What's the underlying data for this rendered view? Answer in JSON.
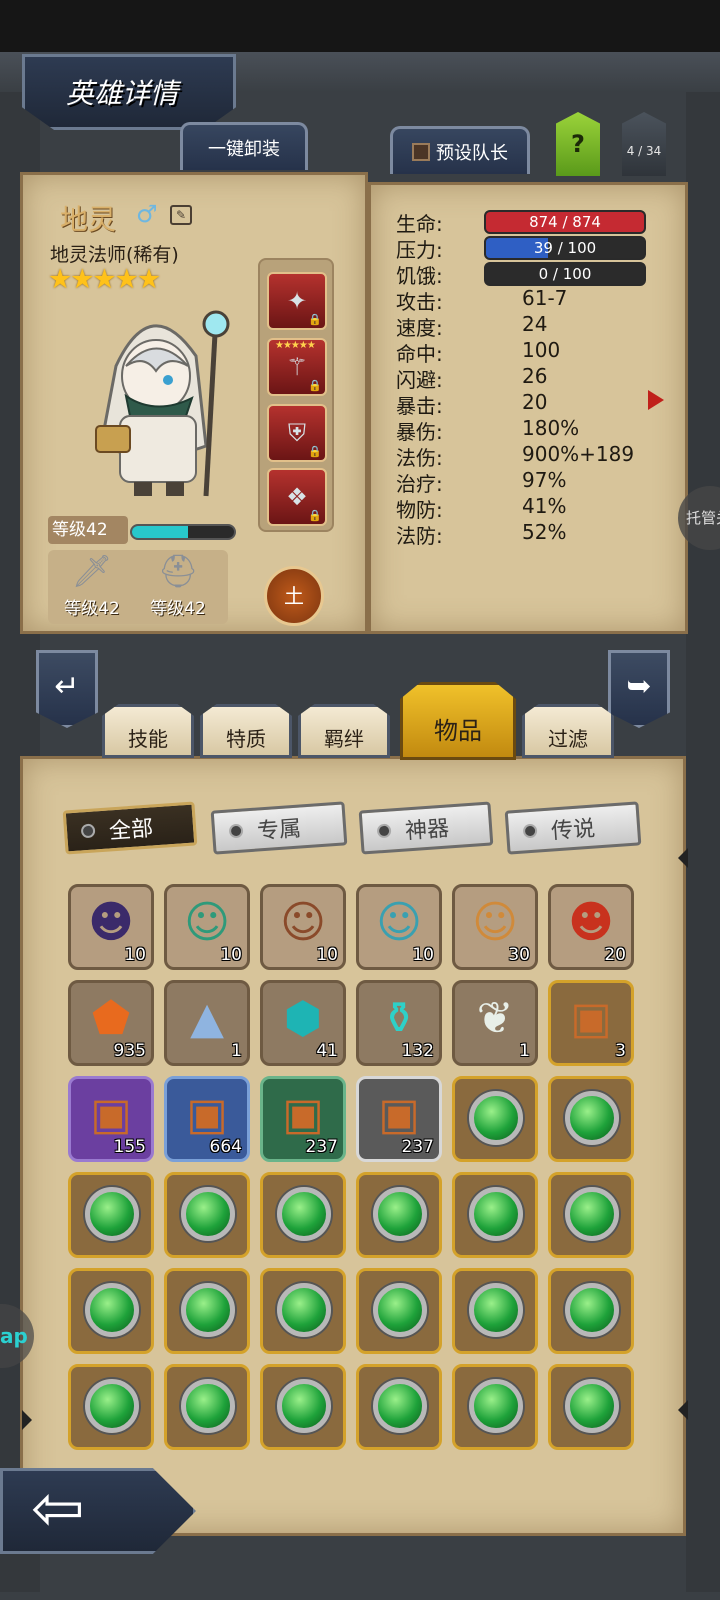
{
  "header": {
    "title": "英雄详情"
  },
  "top_buttons": {
    "unequip_all": "一键卸装",
    "preset_leader": "预设队长",
    "help": "?",
    "hero_count": "4 / 34"
  },
  "hero": {
    "name": "地灵",
    "gender_icon": "male-icon",
    "class": "地灵法师(稀有)",
    "stars": "★★★★★",
    "level_label": "等级42",
    "xp_progress": 0.55,
    "element": "土",
    "weapon_level": "等级42",
    "armor_level": "等级42",
    "equip_slots": [
      {
        "icon": "shuriken-icon",
        "glyph": "✦"
      },
      {
        "icon": "staff-icon",
        "glyph": "⚚",
        "stars": "★★★★★"
      },
      {
        "icon": "helmet-icon",
        "glyph": "⛨"
      },
      {
        "icon": "cloak-icon",
        "glyph": "❖"
      }
    ]
  },
  "stats": {
    "hp": {
      "label": "生命:",
      "value": "874 / 874",
      "ratio": 1.0,
      "color": "#c52a32"
    },
    "stress": {
      "label": "压力:",
      "value": "39 / 100",
      "ratio": 0.39,
      "color": "#2f5fc4"
    },
    "hunger": {
      "label": "饥饿:",
      "value": "0 / 100",
      "ratio": 0.0,
      "color": "#888888"
    },
    "rows": [
      {
        "label": "攻击:",
        "value": "61-7"
      },
      {
        "label": "速度:",
        "value": "24"
      },
      {
        "label": "命中:",
        "value": "100"
      },
      {
        "label": "闪避:",
        "value": "26"
      },
      {
        "label": "暴击:",
        "value": "20"
      },
      {
        "label": "暴伤:",
        "value": "180%"
      },
      {
        "label": "法伤:",
        "value": "900%+189"
      },
      {
        "label": "治疗:",
        "value": "97%"
      },
      {
        "label": "物防:",
        "value": "41%"
      },
      {
        "label": "法防:",
        "value": "52%"
      }
    ]
  },
  "auto_button": "托管关",
  "main_tabs": [
    "技能",
    "特质",
    "羁绊",
    "物品",
    "过滤"
  ],
  "active_tab": "物品",
  "sub_tabs": [
    "全部",
    "专属",
    "神器",
    "传说"
  ],
  "inventory": [
    {
      "kind": "hero",
      "glyph": "☻",
      "color": "#3b2a6a",
      "qty": "10"
    },
    {
      "kind": "hero",
      "glyph": "☺",
      "color": "#2f9a7a",
      "qty": "10"
    },
    {
      "kind": "hero",
      "glyph": "☺",
      "color": "#8a4a2a",
      "qty": "10"
    },
    {
      "kind": "hero",
      "glyph": "☺",
      "color": "#3aa0b0",
      "qty": "10"
    },
    {
      "kind": "hero",
      "glyph": "☺",
      "color": "#d08a3a",
      "qty": "30"
    },
    {
      "kind": "hero",
      "glyph": "☻",
      "color": "#c8321e",
      "qty": "20"
    },
    {
      "kind": "item",
      "glyph": "⬟",
      "color": "#e86a1e",
      "qty": "935"
    },
    {
      "kind": "item",
      "glyph": "▲",
      "color": "#8fb4e0",
      "qty": "1"
    },
    {
      "kind": "item",
      "glyph": "⬢",
      "color": "#1eb4b4",
      "qty": "41"
    },
    {
      "kind": "item",
      "glyph": "⚱",
      "color": "#2ed0c8",
      "qty": "132"
    },
    {
      "kind": "item",
      "glyph": "❦",
      "color": "#e8efe8",
      "qty": "1"
    },
    {
      "kind": "gold",
      "glyph": "▣",
      "color": "#c86a2a",
      "qty": "3"
    },
    {
      "kind": "purple",
      "glyph": "▣",
      "color": "#c86a2a",
      "qty": "155"
    },
    {
      "kind": "blue",
      "glyph": "▣",
      "color": "#c86a2a",
      "qty": "664"
    },
    {
      "kind": "green",
      "glyph": "▣",
      "color": "#c86a2a",
      "qty": "237"
    },
    {
      "kind": "grey",
      "glyph": "▣",
      "color": "#c86a2a",
      "qty": "237"
    },
    {
      "kind": "gem",
      "qty": ""
    },
    {
      "kind": "gem",
      "qty": ""
    },
    {
      "kind": "gem",
      "qty": ""
    },
    {
      "kind": "gem",
      "qty": ""
    },
    {
      "kind": "gem",
      "qty": ""
    },
    {
      "kind": "gem",
      "qty": ""
    },
    {
      "kind": "gem",
      "qty": ""
    },
    {
      "kind": "gem",
      "qty": ""
    },
    {
      "kind": "gem",
      "qty": ""
    },
    {
      "kind": "gem",
      "qty": ""
    },
    {
      "kind": "gem",
      "qty": ""
    },
    {
      "kind": "gem",
      "qty": ""
    },
    {
      "kind": "gem",
      "qty": ""
    },
    {
      "kind": "gem",
      "qty": ""
    },
    {
      "kind": "gem",
      "qty": ""
    },
    {
      "kind": "gem",
      "qty": ""
    },
    {
      "kind": "gem",
      "qty": ""
    },
    {
      "kind": "gem",
      "qty": ""
    },
    {
      "kind": "gem",
      "qty": ""
    },
    {
      "kind": "gem",
      "qty": ""
    }
  ],
  "floating_app": "ap"
}
